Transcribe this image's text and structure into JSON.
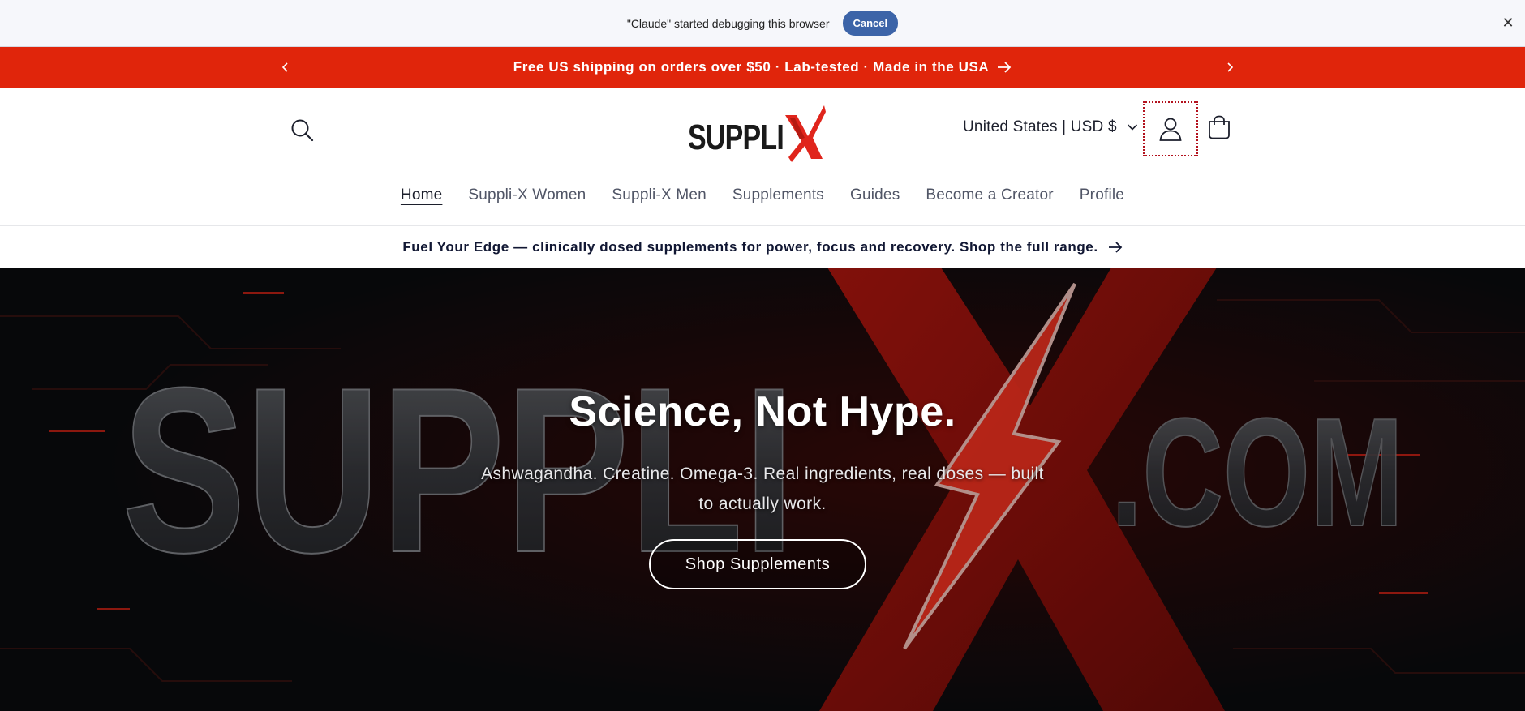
{
  "debug_bar": {
    "message": "\"Claude\" started debugging this browser",
    "cancel_label": "Cancel",
    "close_glyph": "✕"
  },
  "announcement": {
    "text": "Free US shipping on orders over $50 · Lab-tested · Made in the USA",
    "background": "#e0250b"
  },
  "header": {
    "logo_text": "SUPPLI",
    "logo_mark": "X",
    "region": "United States | USD $",
    "icons": [
      "search-icon",
      "account-icon",
      "cart-icon"
    ]
  },
  "nav": {
    "items": [
      {
        "label": "Home",
        "active": true
      },
      {
        "label": "Suppli-X Women"
      },
      {
        "label": "Suppli-X Men"
      },
      {
        "label": "Supplements"
      },
      {
        "label": "Guides"
      },
      {
        "label": "Become a Creator"
      },
      {
        "label": "Profile"
      }
    ]
  },
  "promo": {
    "text": "Fuel Your Edge — clinically dosed supplements for power, focus and recovery. Shop the full range."
  },
  "hero": {
    "title": "Science, Not Hype.",
    "subtitle": "Ashwagandha. Creatine. Omega-3. Real ingredients, real doses — built to actually work.",
    "cta_label": "Shop Supplements",
    "bg_word": "SUPPLI",
    "bg_mark": "X",
    "bg_suffix": ".COM",
    "accent": "#ff2a1a"
  }
}
